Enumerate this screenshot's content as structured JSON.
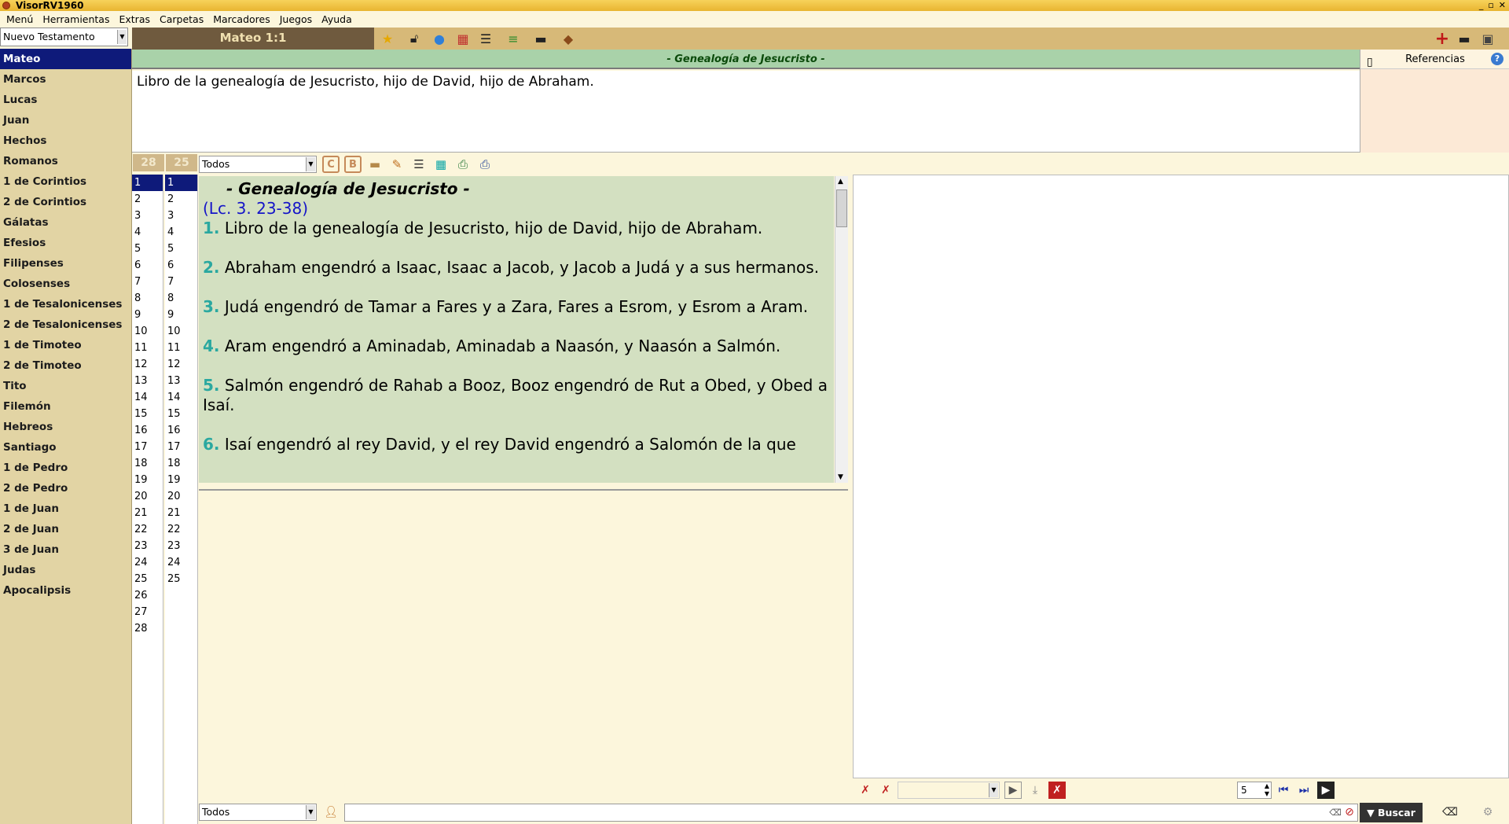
{
  "window": {
    "title": "VisorRV1960",
    "controls": [
      "_",
      "▫",
      "✕"
    ]
  },
  "menu": [
    "Menú",
    "Herramientas",
    "Extras",
    "Carpetas",
    "Marcadores",
    "Juegos",
    "Ayuda"
  ],
  "testament_select": "Nuevo Testamento",
  "current_ref": "Mateo 1:1",
  "books": [
    "Mateo",
    "Marcos",
    "Lucas",
    "Juan",
    "Hechos",
    "Romanos",
    "1 de Corintios",
    "2 de Corintios",
    "Gálatas",
    "Efesios",
    "Filipenses",
    "Colosenses",
    "1 de Tesalonicenses",
    "2 de Tesalonicenses",
    "1 de Timoteo",
    "2 de Timoteo",
    "Tito",
    "Filemón",
    "Hebreos",
    "Santiago",
    "1 de Pedro",
    "2 de Pedro",
    "1 de Juan",
    "2 de Juan",
    "3 de Juan",
    "Judas",
    "Apocalipsis"
  ],
  "selected_book": "Mateo",
  "section_heading": "- Genealogía de Jesucristo -",
  "top_verse": "Libro de la genealogía de Jesucristo, hijo de David, hijo de Abraham.",
  "references_label": "Referencias",
  "chapter_count": "28",
  "verse_count": "25",
  "filter_top": "Todos",
  "filter_bottom": "Todos",
  "reading": {
    "title": "- Genealogía de Jesucristo -",
    "cross_ref": "(Lc. 3. 23-38)",
    "verses": [
      {
        "n": "1.",
        "text": "Libro de la genealogía de Jesucristo, hijo de David, hijo de Abraham."
      },
      {
        "n": "2.",
        "text": "Abraham engendró a Isaac, Isaac a Jacob, y Jacob a Judá y a sus hermanos."
      },
      {
        "n": "3.",
        "text": "Judá engendró de Tamar a Fares y a Zara, Fares a Esrom, y Esrom a Aram."
      },
      {
        "n": "4.",
        "text": "Aram engendró a Aminadab, Aminadab a Naasón, y Naasón a Salmón."
      },
      {
        "n": "5.",
        "text": "Salmón engendró de Rahab a Booz, Booz engendró de Rut a Obed, y Obed a Isaí."
      },
      {
        "n": "6.",
        "text": "Isaí engendró al rey David, y el rey David engendró a Salomón de la que"
      }
    ]
  },
  "spin_value": "5",
  "search_button": "Buscar"
}
